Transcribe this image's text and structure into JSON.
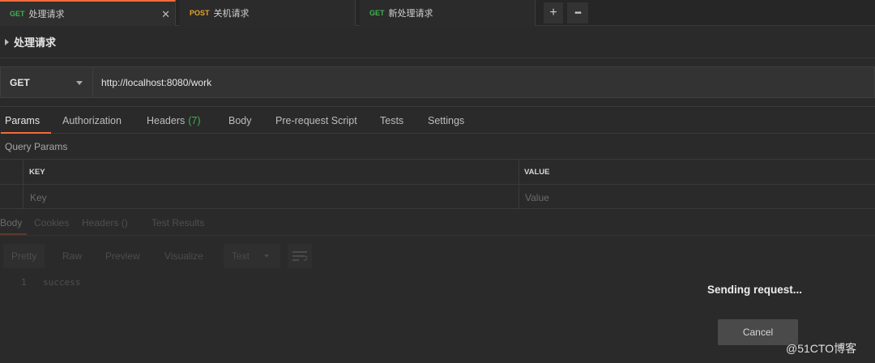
{
  "tabs": [
    {
      "method": "GET",
      "method_color": "#3fb24f",
      "name": "处理请求",
      "active": true
    },
    {
      "method": "POST",
      "method_color": "#e6a42b",
      "name": "关机请求"
    },
    {
      "method": "GET",
      "method_color": "#3fb24f",
      "name": "新处理请求"
    }
  ],
  "tab_actions": {
    "add_icon": "+",
    "more_icon": "•••"
  },
  "request": {
    "name": "处理请求",
    "method": "GET",
    "url": "http://localhost:8080/work"
  },
  "request_tabs": [
    {
      "label": "Params"
    },
    {
      "label": "Authorization"
    },
    {
      "label": "Headers",
      "count": "(7)"
    },
    {
      "label": "Body"
    },
    {
      "label": "Pre-request Script"
    },
    {
      "label": "Tests"
    },
    {
      "label": "Settings"
    }
  ],
  "query_params": {
    "title": "Query Params",
    "columns": [
      "KEY",
      "VALUE"
    ],
    "placeholders": [
      "Key",
      "Value"
    ]
  },
  "response_tabs": [
    {
      "label": "Body"
    },
    {
      "label": "Cookies"
    },
    {
      "label": "Headers",
      "count": "()"
    },
    {
      "label": "Test Results"
    }
  ],
  "response_toolbar": {
    "views": [
      "Pretty",
      "Raw",
      "Preview",
      "Visualize"
    ],
    "format": "Text"
  },
  "response_body": {
    "line_number": "1",
    "text": "success"
  },
  "overlay": {
    "message": "Sending request...",
    "cancel_label": "Cancel"
  },
  "watermark": "@51CTO博客",
  "colors": {
    "accent": "#f26b3a",
    "get": "#3fb24f",
    "post": "#e6a42b"
  }
}
